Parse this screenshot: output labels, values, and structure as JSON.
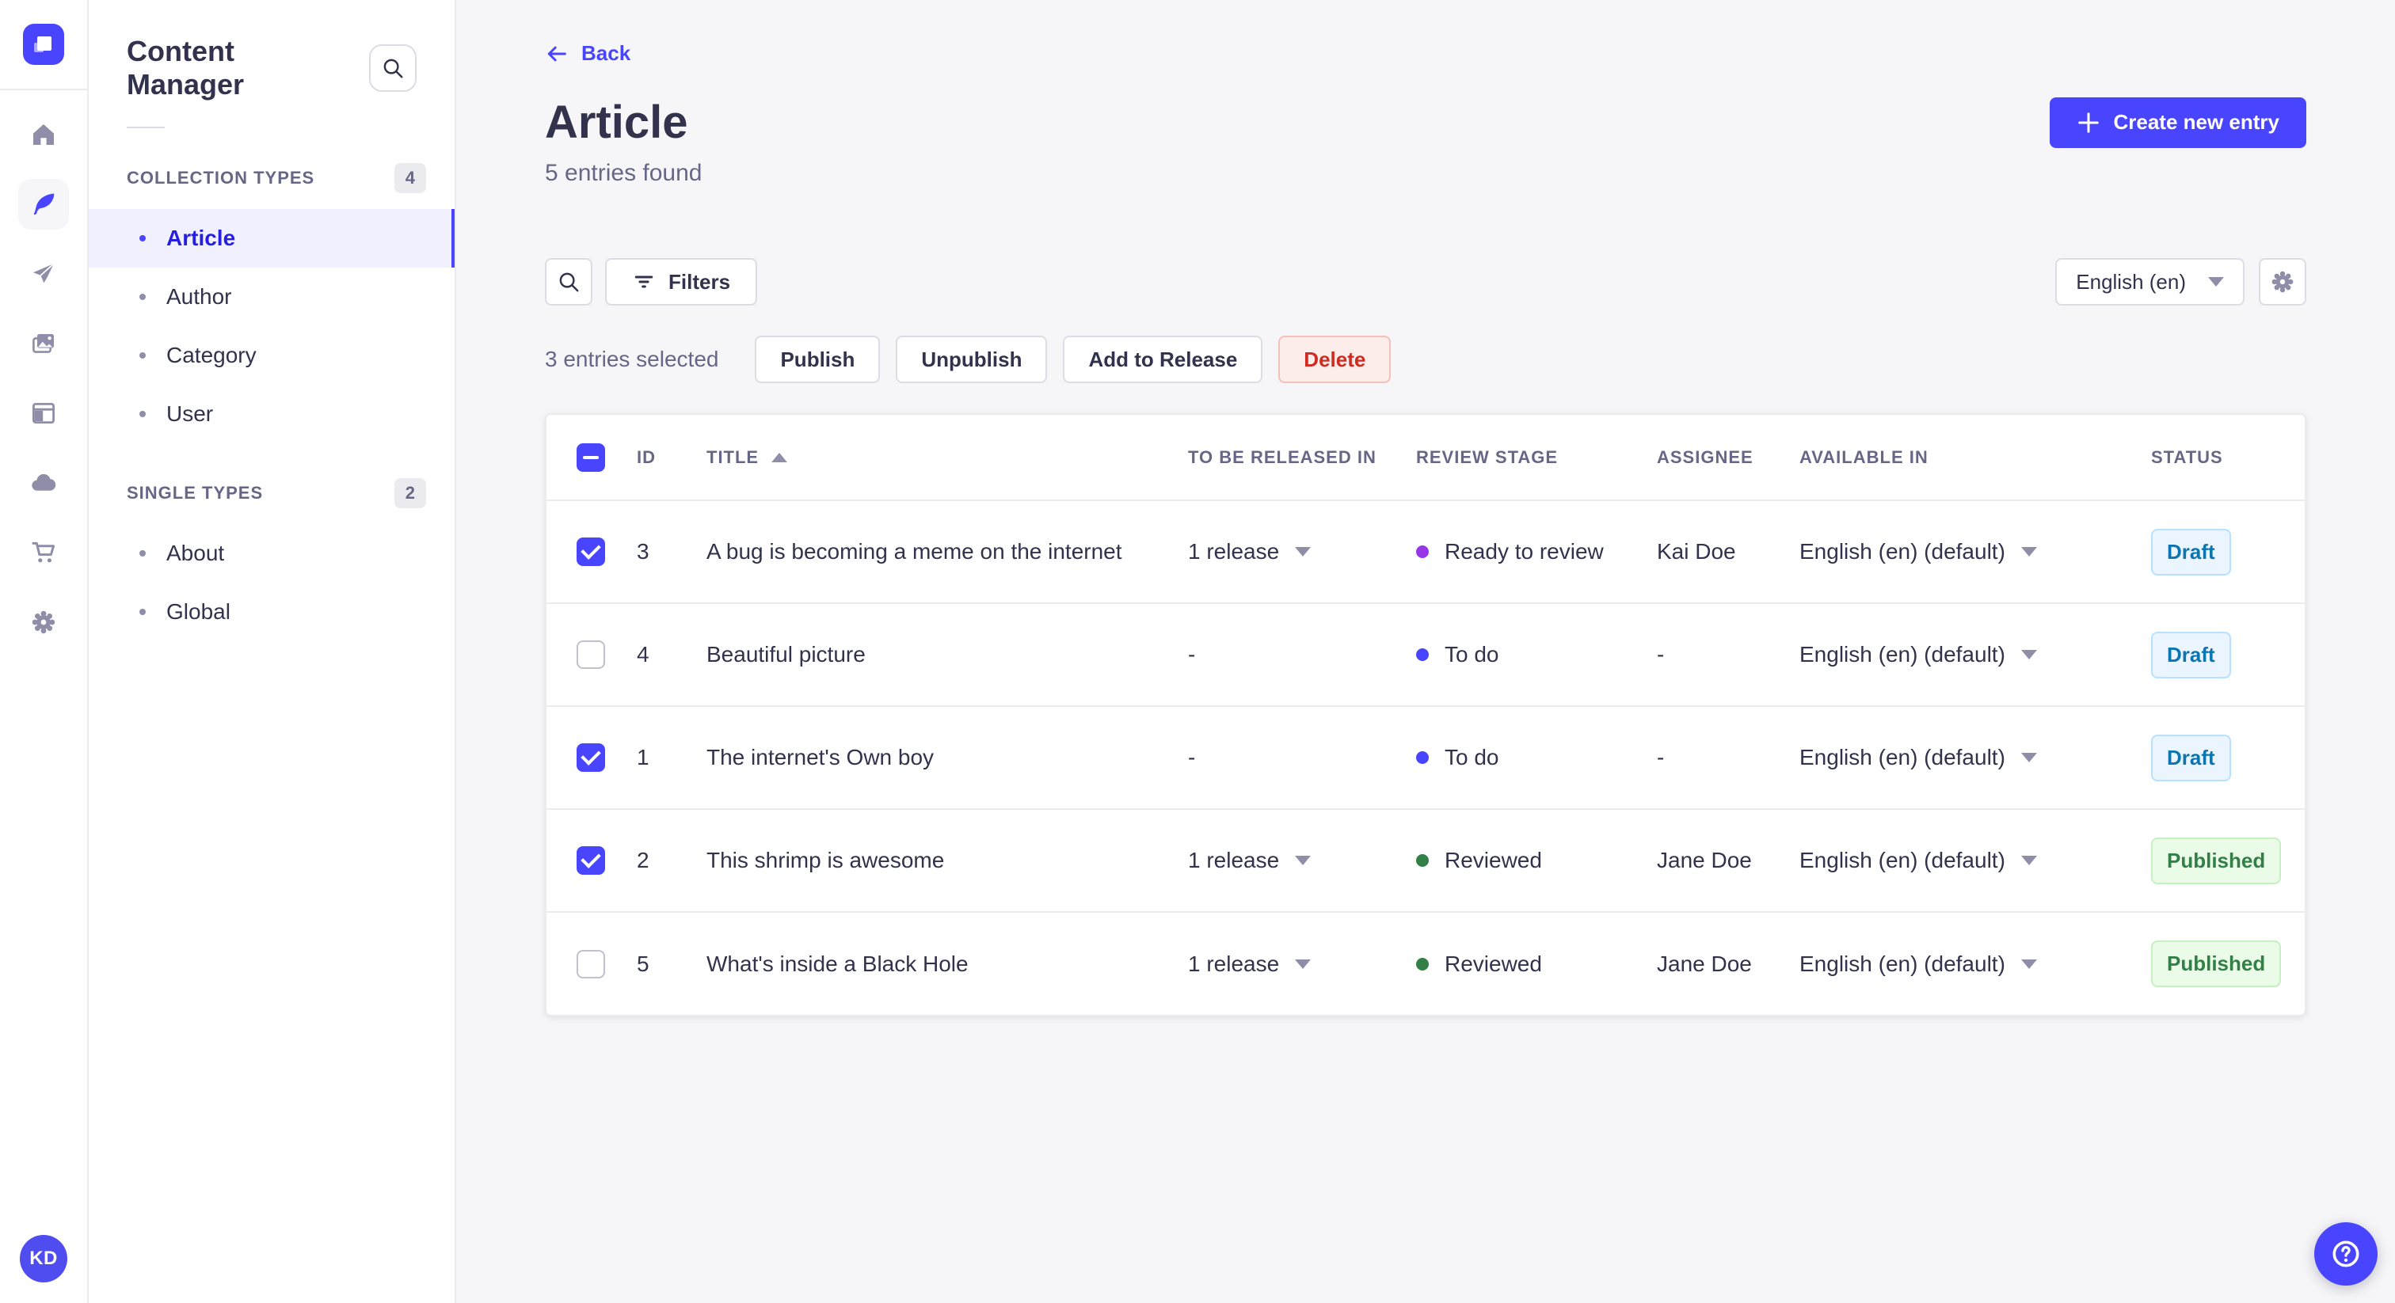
{
  "rail": {
    "logo_icon": "strapi-logo",
    "icons": [
      "home-icon",
      "feather-icon",
      "paper-plane-icon",
      "media-library-icon",
      "layout-icon",
      "cloud-icon",
      "cart-icon",
      "gear-icon"
    ],
    "active_icon": "feather-icon",
    "avatar_initials": "KD"
  },
  "subnav": {
    "title": "Content Manager",
    "search_icon": "search-icon",
    "sections": [
      {
        "label": "COLLECTION TYPES",
        "badge": "4",
        "items": [
          {
            "label": "Article",
            "active": true
          },
          {
            "label": "Author",
            "active": false
          },
          {
            "label": "Category",
            "active": false
          },
          {
            "label": "User",
            "active": false
          }
        ]
      },
      {
        "label": "SINGLE TYPES",
        "badge": "2",
        "items": [
          {
            "label": "About",
            "active": false
          },
          {
            "label": "Global",
            "active": false
          }
        ]
      }
    ]
  },
  "header": {
    "back_label": "Back",
    "title": "Article",
    "subtitle": "5 entries found",
    "create_button": "Create new entry"
  },
  "toolbar": {
    "search_icon": "search-icon",
    "filters_label": "Filters",
    "filters_icon": "filter-icon",
    "locale": "English (en)",
    "settings_icon": "gear-icon"
  },
  "selection": {
    "text": "3 entries selected",
    "publish": "Publish",
    "unpublish": "Unpublish",
    "add_to_release": "Add to Release",
    "delete": "Delete"
  },
  "table": {
    "select_all_state": "indeterminate",
    "columns": [
      "ID",
      "TITLE",
      "TO BE RELEASED IN",
      "REVIEW STAGE",
      "ASSIGNEE",
      "AVAILABLE IN",
      "STATUS"
    ],
    "sort": {
      "column": "TITLE",
      "direction": "asc"
    },
    "rows": [
      {
        "checked": true,
        "id": "3",
        "title": "A bug is becoming a meme on the internet",
        "release": "1 release",
        "stage": "Ready to review",
        "stage_color": "#9736e8",
        "assignee": "Kai Doe",
        "locale": "English (en) (default)",
        "status": "Draft",
        "status_type": "draft"
      },
      {
        "checked": false,
        "id": "4",
        "title": "Beautiful picture",
        "release": "-",
        "stage": "To do",
        "stage_color": "#4945ff",
        "assignee": "-",
        "locale": "English (en) (default)",
        "status": "Draft",
        "status_type": "draft"
      },
      {
        "checked": true,
        "id": "1",
        "title": "The internet's Own boy",
        "release": "-",
        "stage": "To do",
        "stage_color": "#4945ff",
        "assignee": "-",
        "locale": "English (en) (default)",
        "status": "Draft",
        "status_type": "draft"
      },
      {
        "checked": true,
        "id": "2",
        "title": "This shrimp is awesome",
        "release": "1 release",
        "stage": "Reviewed",
        "stage_color": "#328048",
        "assignee": "Jane Doe",
        "locale": "English (en) (default)",
        "status": "Published",
        "status_type": "published"
      },
      {
        "checked": false,
        "id": "5",
        "title": "What's inside a Black Hole",
        "release": "1 release",
        "stage": "Reviewed",
        "stage_color": "#328048",
        "assignee": "Jane Doe",
        "locale": "English (en) (default)",
        "status": "Published",
        "status_type": "published"
      }
    ]
  },
  "fab": {
    "help_icon": "question-circle-icon"
  },
  "colors": {
    "primary": "#4945ff",
    "primary_dark_text": "#271fe0",
    "primary_light_bg": "#f0f0ff",
    "text": "#32324d",
    "text_secondary": "#666687",
    "icon_gray": "#8e8ea9",
    "border": "#dcdce4",
    "page_bg": "#f6f6f9",
    "draft_bg": "#eaf5ff",
    "draft_text": "#0c75af",
    "published_bg": "#eafbe7",
    "published_text": "#328048",
    "danger_bg": "#fcecea",
    "danger_text": "#d02b20",
    "stage_todo": "#4945ff",
    "stage_ready": "#9736e8",
    "stage_reviewed": "#328048"
  }
}
